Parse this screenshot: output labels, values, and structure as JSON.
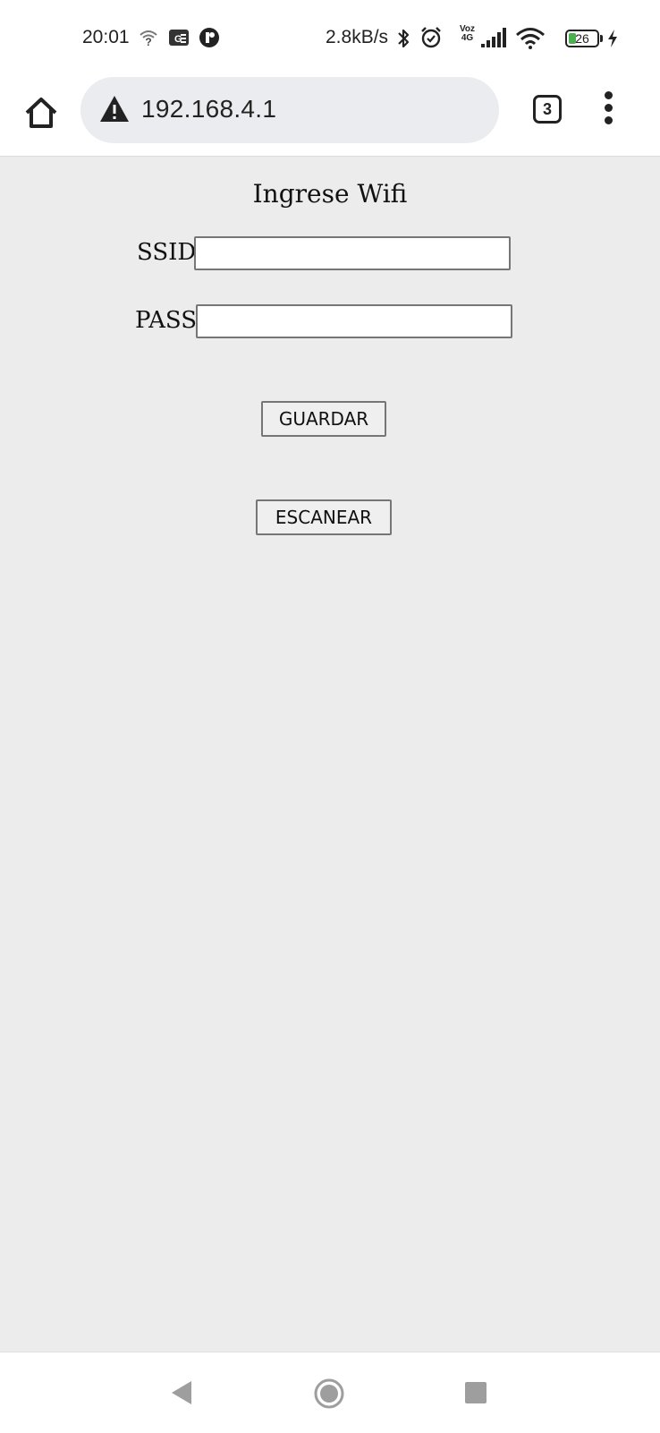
{
  "status_bar": {
    "time": "20:01",
    "network_speed": "2.8kB/s",
    "volte_top": "Voz",
    "volte_bottom": "4G",
    "battery_level": "26",
    "icons": [
      "wifi-question-icon",
      "news-icon",
      "app-circle-icon",
      "bluetooth-icon",
      "alarm-icon",
      "signal-icon",
      "wifi-icon",
      "battery-icon",
      "charging-icon"
    ]
  },
  "browser": {
    "url": "192.168.4.1",
    "tab_count": "3",
    "icons": [
      "home-icon",
      "not-secure-warning-icon",
      "tabs-icon",
      "more-menu-icon"
    ]
  },
  "page": {
    "title": "Ingrese Wifi",
    "ssid_label": "SSID",
    "ssid_value": "",
    "pass_label": "PASS",
    "pass_value": "",
    "save_button": "GUARDAR",
    "scan_button": "ESCANEAR",
    "background_color": "#ececec"
  },
  "nav_bar": {
    "icons": [
      "back-icon",
      "home-circle-icon",
      "recents-icon"
    ]
  }
}
